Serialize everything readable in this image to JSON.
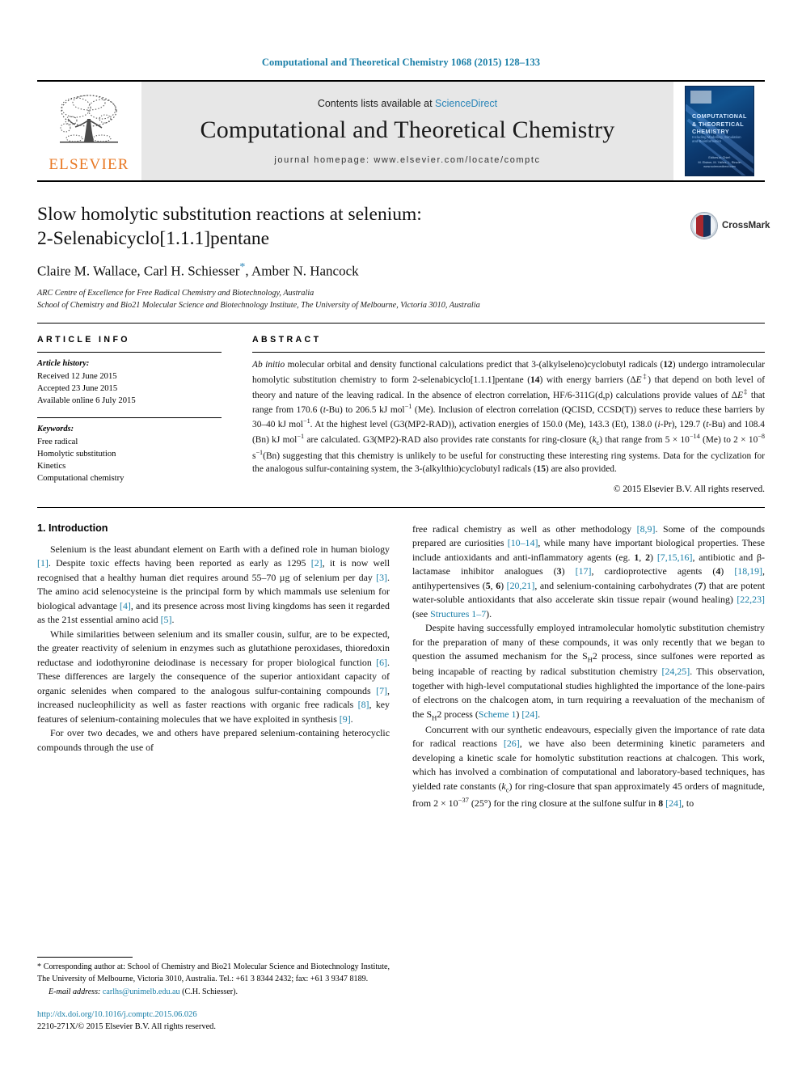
{
  "running_head": "Computational and Theoretical Chemistry 1068 (2015) 128–133",
  "masthead": {
    "publisher_name": "ELSEVIER",
    "contents_prefix": "Contents lists available at ",
    "sciencedirect": "ScienceDirect",
    "journal_name": "Computational and Theoretical Chemistry",
    "homepage": "journal homepage: www.elsevier.com/locate/comptc",
    "cover": {
      "title_line1": "COMPUTATIONAL",
      "title_line2": "& THEORETICAL",
      "title_line3": "CHEMISTRY",
      "subtitle": "Including Modelling, Simulation and Bioinformatics",
      "bottom_line1": "Editors-in-Chief:",
      "bottom_line2": "M. Elstner, M. Yáñez, L. Rincón",
      "bottom_line3": "www.sciencedirect.com"
    }
  },
  "article": {
    "title_line1": "Slow homolytic substitution reactions at selenium:",
    "title_line2": "2-Selenabicyclo[1.1.1]pentane",
    "authors_pre": "Claire M. Wallace, Carl H. Schiesser",
    "authors_star": "*",
    "authors_post": ", Amber N. Hancock",
    "affiliation_1": "ARC Centre of Excellence for Free Radical Chemistry and Biotechnology, Australia",
    "affiliation_2": "School of Chemistry and Bio21 Molecular Science and Biotechnology Institute, The University of Melbourne, Victoria 3010, Australia",
    "crossmark_label": "CrossMark"
  },
  "info": {
    "heading": "ARTICLE INFO",
    "history_label": "Article history:",
    "received": "Received 12 June 2015",
    "accepted": "Accepted 23 June 2015",
    "available": "Available online 6 July 2015",
    "keywords_label": "Keywords:",
    "keywords": [
      "Free radical",
      "Homolytic substitution",
      "Kinetics",
      "Computational chemistry"
    ]
  },
  "abstract": {
    "heading": "ABSTRACT",
    "copyright": "© 2015 Elsevier B.V. All rights reserved."
  },
  "intro": {
    "heading": "1. Introduction"
  },
  "footnote": {
    "corresponding": "* Corresponding author at: School of Chemistry and Bio21 Molecular Science and Biotechnology Institute, The University of Melbourne, Victoria 3010, Australia. Tel.: +61 3 8344 2432; fax: +61 3 9347 8189.",
    "email_label": "E-mail address:",
    "email": "carlhs@unimelb.edu.au",
    "email_owner": "(C.H. Schiesser).",
    "doi": "http://dx.doi.org/10.1016/j.comptc.2015.06.026",
    "issn_line": "2210-271X/© 2015 Elsevier B.V. All rights reserved."
  },
  "colors": {
    "link": "#1a7fa8",
    "elsevier_orange": "#e87722",
    "masthead_gray": "#e7e7e7"
  }
}
